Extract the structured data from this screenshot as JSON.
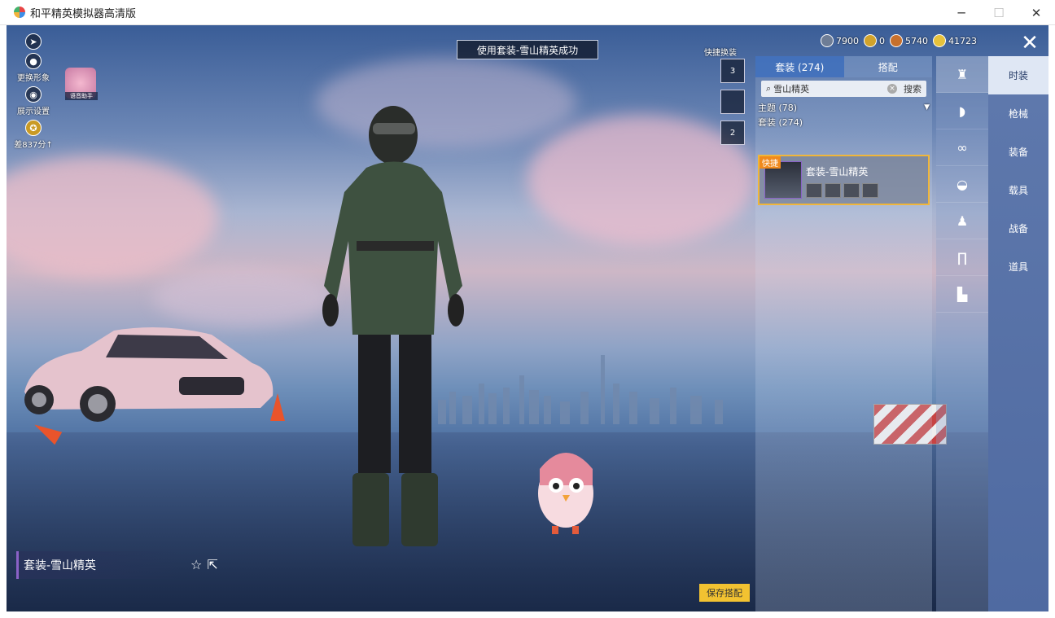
{
  "window": {
    "title": "和平精英模拟器高清版",
    "minimize": "─",
    "maximize": "☐",
    "close": "✕"
  },
  "banner": "使用套装-雪山精英成功",
  "left_tools": [
    {
      "icon": "play-icon",
      "glyph": "➤",
      "label": ""
    },
    {
      "icon": "avatar-icon",
      "glyph": "●",
      "label": "更换形象"
    },
    {
      "icon": "eye-icon",
      "glyph": "◉",
      "label": "展示设置"
    },
    {
      "icon": "rank-icon",
      "glyph": "✪",
      "label": "差837分↑"
    }
  ],
  "voice_assistant": "语音助手",
  "currencies": [
    {
      "value": "7900",
      "color": "#6e7d96"
    },
    {
      "value": "0",
      "color": "#d1a32c"
    },
    {
      "value": "5740",
      "color": "#c7702d"
    },
    {
      "value": "41723",
      "color": "#e6c23c"
    }
  ],
  "close_icon": "✕",
  "quick_change": {
    "label": "快捷换装",
    "slots": [
      "3",
      "",
      "2"
    ]
  },
  "panel": {
    "tabs": [
      "套装 (274)",
      "搭配"
    ],
    "search": {
      "value": "雪山精英",
      "button": "搜索"
    },
    "filters": [
      "主题 (78)",
      "套装 (274)"
    ],
    "card": {
      "badge": "快捷",
      "name": "套装-雪山精英"
    }
  },
  "menu": [
    "时装",
    "枪械",
    "装备",
    "载具",
    "战备",
    "道具"
  ],
  "outfit_name": "套装-雪山精英",
  "save_button": "保存搭配"
}
